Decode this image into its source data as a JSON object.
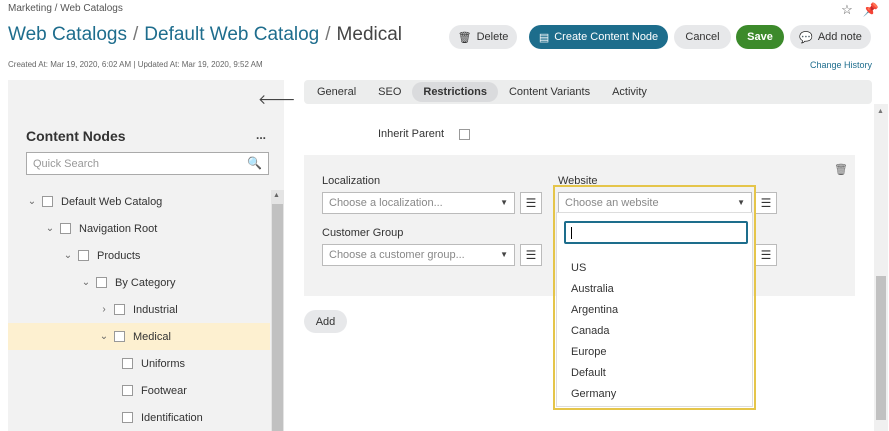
{
  "header": {
    "breadcrumb": "Marketing / Web Catalogs",
    "title_parts": [
      "Web Catalogs",
      "/",
      "Default Web Catalog",
      "/",
      "Medical"
    ],
    "meta": "Created At: Mar 19, 2020, 6:02 AM  |  Updated At: Mar 19, 2020, 9:52 AM",
    "change_history": "Change History",
    "icons": [
      "star-icon",
      "pin-icon"
    ]
  },
  "toolbar": {
    "delete_label": "Delete",
    "create_label": "Create Content Node",
    "cancel_label": "Cancel",
    "save_label": "Save",
    "note_label": "Add note",
    "colors": {
      "primary": "#1d6d8c",
      "save": "#3c8a2b"
    }
  },
  "sidebar": {
    "title": "Content Nodes",
    "menu": "...",
    "search_placeholder": "Quick Search",
    "tree": [
      {
        "label": "Default Web Catalog",
        "chevron": "expanded",
        "selected": false
      },
      {
        "label": "Navigation Root",
        "chevron": "expanded",
        "selected": false
      },
      {
        "label": "Products",
        "chevron": "expanded",
        "selected": false
      },
      {
        "label": "By Category",
        "chevron": "expanded",
        "selected": false
      },
      {
        "label": "Industrial",
        "chevron": "collapsed",
        "selected": false
      },
      {
        "label": "Medical",
        "chevron": "expanded",
        "selected": true
      },
      {
        "label": "Uniforms",
        "chevron": "none",
        "selected": false
      },
      {
        "label": "Footwear",
        "chevron": "none",
        "selected": false
      },
      {
        "label": "Identification",
        "chevron": "none",
        "selected": false
      }
    ]
  },
  "tabs": [
    {
      "label": "General",
      "active": false
    },
    {
      "label": "SEO",
      "active": false
    },
    {
      "label": "Restrictions",
      "active": true
    },
    {
      "label": "Content Variants",
      "active": false
    },
    {
      "label": "Activity",
      "active": false
    }
  ],
  "restrictions": {
    "inherit_label": "Inherit Parent",
    "localization_label": "Localization",
    "localization_placeholder": "Choose a localization...",
    "website_label": "Website",
    "website_placeholder": "Choose an website",
    "customer_group_label": "Customer Group",
    "customer_group_placeholder": "Choose a customer group...",
    "add_label": "Add"
  },
  "website_dropdown": {
    "search_value": "",
    "options": [
      "US",
      "Australia",
      "Argentina",
      "Canada",
      "Europe",
      "Default",
      "Germany"
    ]
  }
}
